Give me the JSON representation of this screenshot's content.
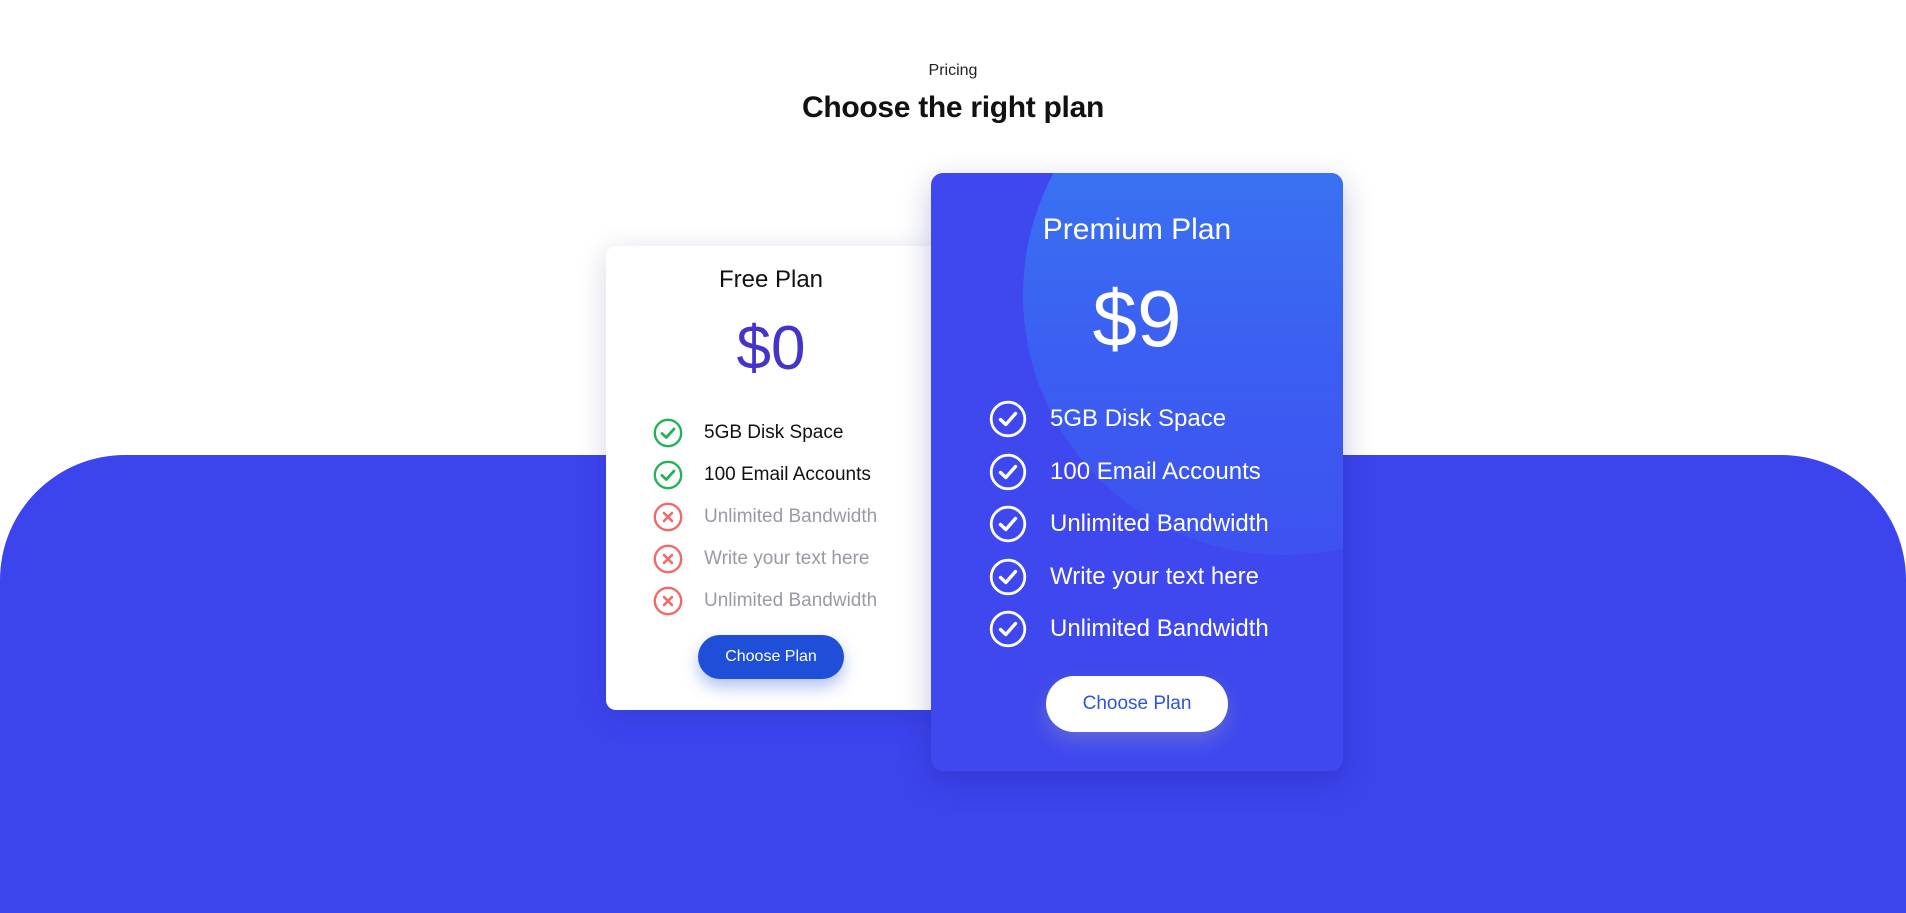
{
  "header": {
    "label": "Pricing",
    "title": "Choose the right plan"
  },
  "colors": {
    "accent_blue": "#3c44ee",
    "free_price": "#4434c9",
    "free_button": "#1f4fd9",
    "check_green": "#22b35a",
    "cross_red": "#f06a6a",
    "muted_text": "#9a9aa4"
  },
  "plans": [
    {
      "name": "Free Plan",
      "price": "$0",
      "button_label": "Choose Plan",
      "features": [
        {
          "text": "5GB Disk Space",
          "included": true,
          "icon": "check-circle-icon"
        },
        {
          "text": "100 Email Accounts",
          "included": true,
          "icon": "check-circle-icon"
        },
        {
          "text": "Unlimited Bandwidth",
          "included": false,
          "icon": "x-circle-icon"
        },
        {
          "text": "Write your text here",
          "included": false,
          "icon": "x-circle-icon"
        },
        {
          "text": "Unlimited Bandwidth",
          "included": false,
          "icon": "x-circle-icon"
        }
      ]
    },
    {
      "name": "Premium Plan",
      "price": "$9",
      "button_label": "Choose Plan",
      "features": [
        {
          "text": "5GB Disk Space",
          "included": true,
          "icon": "check-circle-icon"
        },
        {
          "text": "100 Email Accounts",
          "included": true,
          "icon": "check-circle-icon"
        },
        {
          "text": "Unlimited Bandwidth",
          "included": true,
          "icon": "check-circle-icon"
        },
        {
          "text": "Write your text here",
          "included": true,
          "icon": "check-circle-icon"
        },
        {
          "text": "Unlimited Bandwidth",
          "included": true,
          "icon": "check-circle-icon"
        }
      ]
    }
  ]
}
